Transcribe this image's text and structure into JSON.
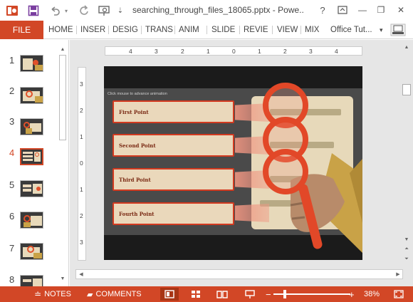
{
  "window": {
    "title": "searching_through_files_18065.pptx - Powe...",
    "help": "?",
    "minimize": "—",
    "restore": "❐",
    "close": "✕"
  },
  "quick_access": {
    "app_icon": "powerpoint-logo",
    "save_icon": "save-icon",
    "undo_icon": "undo-icon",
    "redo_icon": "redo-icon",
    "present_icon": "present-from-start-icon",
    "customize_icon": "customize-qat-icon"
  },
  "ribbon": {
    "file": "FILE",
    "tabs": [
      "HOME",
      "INSER",
      "DESIG",
      "TRANS",
      "ANIM",
      "SLIDE",
      "REVIE",
      "VIEW",
      "MIX"
    ],
    "account": "Office Tut...",
    "collapse": "▾"
  },
  "thumbnails": {
    "numbers": [
      "1",
      "2",
      "3",
      "4",
      "5",
      "6",
      "7",
      "8"
    ],
    "active_index": 4
  },
  "rulers": {
    "horizontal": [
      "4",
      "3",
      "2",
      "1",
      "0",
      "1",
      "2",
      "3",
      "4"
    ],
    "vertical": [
      "3",
      "2",
      "1",
      "0",
      "1",
      "2",
      "3"
    ]
  },
  "slide": {
    "hint": "Click mouse to advance animation",
    "points": [
      "First Point",
      "Second Point",
      "Third Point",
      "Fourth Point"
    ]
  },
  "statusbar": {
    "notes": "NOTES",
    "comments": "COMMENTS",
    "zoom_minus": "−",
    "zoom_plus": "+",
    "zoom": "38%",
    "zoom_value": 0.38
  },
  "colors": {
    "accent": "#d24726",
    "slide_bg": "#4a4a4a",
    "panel": "#e7d9ba",
    "point_border": "#d23a20"
  }
}
